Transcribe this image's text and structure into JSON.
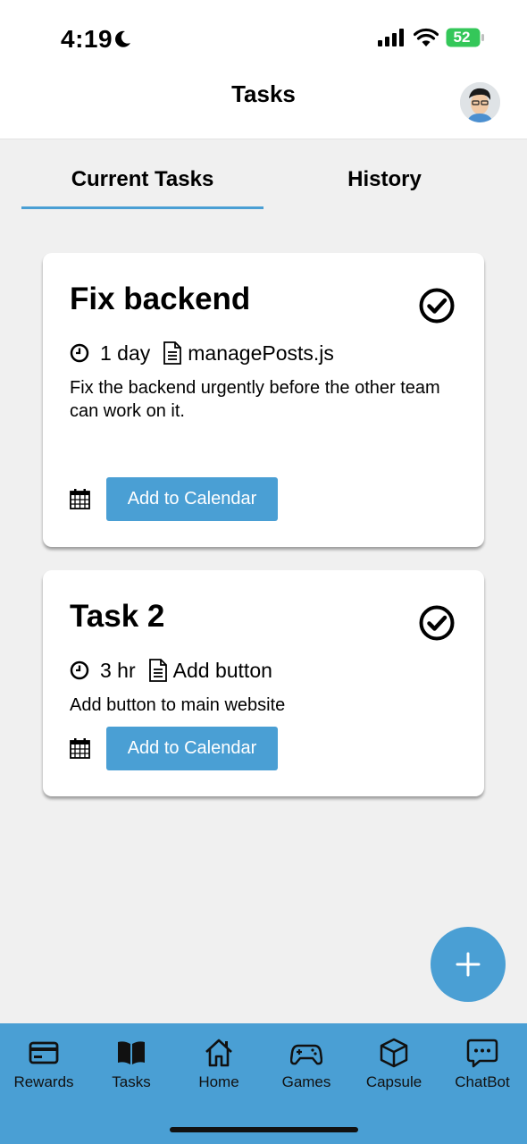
{
  "status_bar": {
    "time": "4:19",
    "battery": "52"
  },
  "header": {
    "title": "Tasks"
  },
  "tabs": [
    {
      "label": "Current Tasks",
      "active": true
    },
    {
      "label": "History",
      "active": false
    }
  ],
  "tasks": [
    {
      "title": "Fix backend",
      "duration": "1 day",
      "file": "managePosts.js",
      "description": "Fix the backend urgently before the other team can work on it.",
      "calendar_label": "Add to Calendar"
    },
    {
      "title": "Task 2",
      "duration": "3 hr",
      "file": "Add button",
      "description": "Add button to main website",
      "calendar_label": "Add to Calendar"
    }
  ],
  "bottom_nav": [
    {
      "label": "Rewards",
      "icon": "card-icon"
    },
    {
      "label": "Tasks",
      "icon": "book-icon"
    },
    {
      "label": "Home",
      "icon": "home-icon"
    },
    {
      "label": "Games",
      "icon": "gamepad-icon"
    },
    {
      "label": "Capsule",
      "icon": "cube-icon"
    },
    {
      "label": "ChatBot",
      "icon": "chat-icon"
    }
  ],
  "colors": {
    "accent": "#4a9fd4",
    "background": "#f0f0f0",
    "battery": "#34c759"
  }
}
